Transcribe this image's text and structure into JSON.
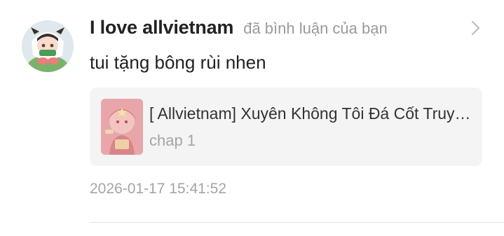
{
  "notification": {
    "user_name": "I love allvietnam",
    "action_text": "đã bình luận của bạn",
    "comment_text": "tui tặng bông rùi nhen",
    "story": {
      "title": "[ Allvietnam] Xuyên Không Tôi Đá Cốt Truyện",
      "chapter": "chap 1"
    },
    "timestamp": "2026-01-17 15:41:52",
    "icons": {
      "avatar": "user-avatar",
      "cover": "story-cover",
      "open": "chevron-right-icon"
    }
  },
  "colors": {
    "username": "#222222",
    "secondary_text": "#9a9a9a",
    "card_background": "#f4f4f4",
    "divider": "#e3e3e3"
  }
}
